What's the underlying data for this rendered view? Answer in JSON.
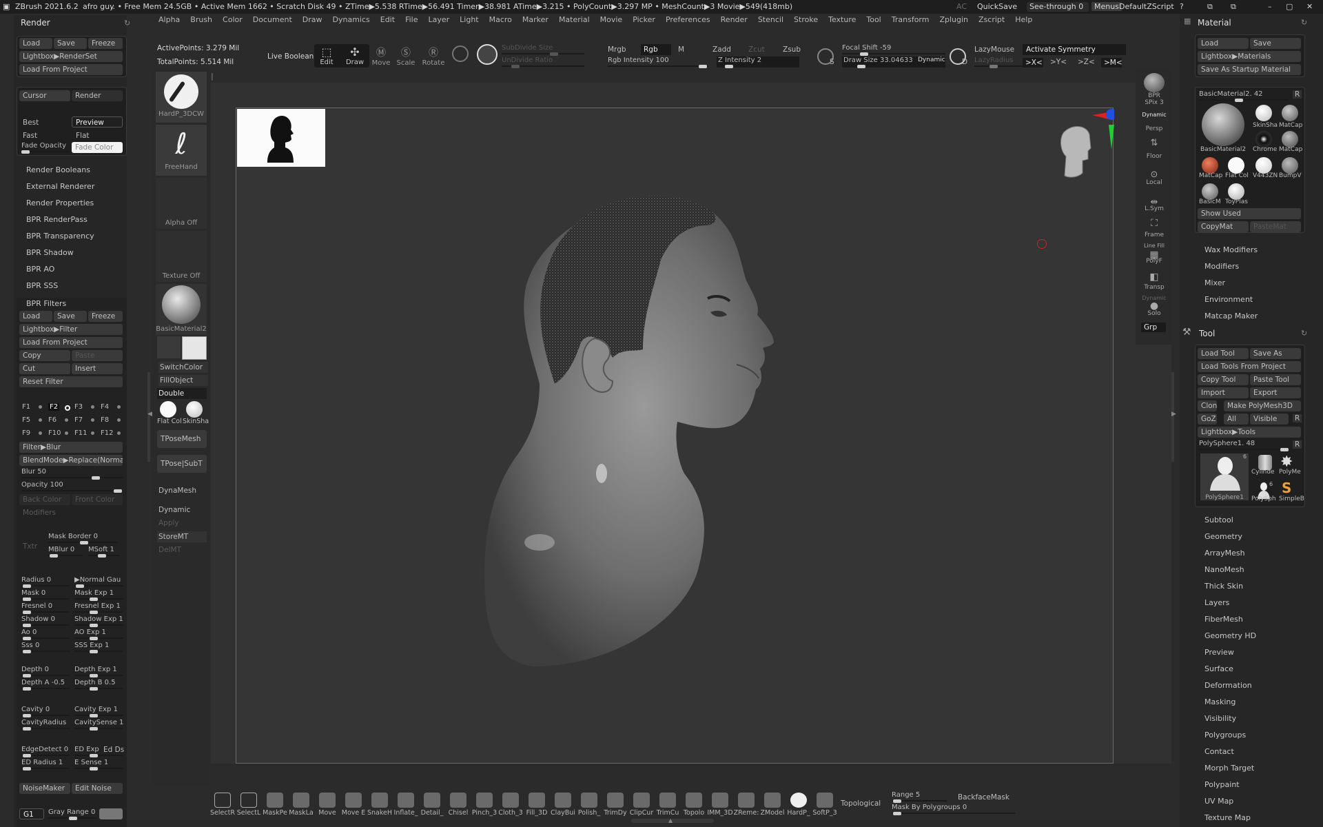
{
  "titlebar": {
    "app": "ZBrush 2021.6.2",
    "project": "afro guy",
    "stats": ".. • Free Mem 24.5GB • Active Mem 1662 • Scratch Disk 49 •  ZTime▶5.538 RTime▶56.491 Timer▶38.981 ATime▶3.215 • PolyCount▶3.297 MP • MeshCount▶3  Movie▶549(418mb)",
    "ac": "AC",
    "quicksave": "QuickSave",
    "seethrough": "See-through  0",
    "menus": "Menus",
    "script": "DefaultZScript"
  },
  "menubar": [
    "Alpha",
    "Brush",
    "Color",
    "Document",
    "Draw",
    "Dynamics",
    "Edit",
    "File",
    "Layer",
    "Light",
    "Macro",
    "Marker",
    "Material",
    "Movie",
    "Picker",
    "Preferences",
    "Render",
    "Stencil",
    "Stroke",
    "Texture",
    "Tool",
    "Transform",
    "Zplugin",
    "Zscript",
    "Help"
  ],
  "left": {
    "title": "Render",
    "load": "Load",
    "save": "Save",
    "freeze": "Freeze",
    "lightbox": "Lightbox▶RenderSet",
    "loadproj": "Load From Project",
    "cursor": "Cursor",
    "render": "Render",
    "best": "Best",
    "preview": "Preview",
    "fast": "Fast",
    "flat": "Flat",
    "fadeopacity": "Fade Opacity",
    "fadecolor": "Fade Color",
    "items": [
      "Render Booleans",
      "External Renderer",
      "Render Properties",
      "BPR RenderPass",
      "BPR Transparency",
      "BPR Shadow",
      "BPR AO",
      "BPR SSS"
    ],
    "filters": "BPR Filters",
    "f_load": "Load",
    "f_save": "Save",
    "f_freeze": "Freeze",
    "f_lightbox": "Lightbox▶Filter",
    "f_loadproj": "Load From Project",
    "copy": "Copy",
    "paste": "Paste",
    "cut": "Cut",
    "insert": "Insert",
    "reset": "Reset Filter",
    "fkeys": [
      "F1",
      "F2",
      "F3",
      "F4",
      "F5",
      "F6",
      "F7",
      "F8",
      "F9",
      "F10",
      "F11",
      "F12"
    ],
    "filterblur": "Filter▶Blur",
    "blendmode": "BlendMode▶Replace(Normal)",
    "blur": "Blur 50",
    "opacity": "Opacity 100",
    "backcolor": "Back Color",
    "frontcolor": "Front Color",
    "modifiers": "Modifiers",
    "txtr": "Txtr",
    "maskborder": "Mask Border  0",
    "mblur": "MBlur  0",
    "msoft": "MSoft  1",
    "radius": "Radius  0",
    "normalgau": "▶Normal Gau",
    "mask": "Mask  0",
    "maskexp": "Mask Exp  1",
    "fresnel": "Fresnel  0",
    "fresnelexp": "Fresnel Exp  1",
    "shadow": "Shadow  0",
    "shadowexp": "Shadow Exp  1",
    "ao": "Ao  0",
    "aoexp": "AO Exp  1",
    "sss": "Sss  0",
    "sssexp": "SSS Exp  1",
    "depth": "Depth  0",
    "depthexp": "Depth Exp  1",
    "deptha": "Depth A  -0.5",
    "depthb": "Depth B  0.5",
    "cavity": "Cavity  0",
    "cavityexp": "Cavity Exp  1",
    "cavityradius": "CavityRadius",
    "cavitysense": "CavitySense  1",
    "edgedetect": "EdgeDetect  0",
    "edexp": "ED Exp",
    "edds": "Ed Ds",
    "edradius": "ED Radius  1",
    "esense": "E Sense  1",
    "noisemaker": "NoiseMaker",
    "editnoise": "Edit Noise",
    "g1": "G1",
    "grayrange": "Gray Range  0"
  },
  "shelf": {
    "brush": "HardP_3DCW",
    "stroke": "FreeHand",
    "alpha": "Alpha Off",
    "texture": "Texture Off",
    "material": "BasicMaterial2",
    "switchcolor": "SwitchColor",
    "fillobject": "FillObject",
    "double": "Double",
    "flatcol": "Flat Col",
    "skinsha": "SkinSha",
    "tposemesh": "TPoseMesh",
    "tposesubt": "TPose|SubT",
    "dynamesh": "DynaMesh",
    "dynamic": "Dynamic",
    "apply": "Apply",
    "storemt": "StoreMT",
    "delmt": "DelMT"
  },
  "topbar": {
    "activepoints": "ActivePoints: 3.279 Mil",
    "totalpoints": "TotalPoints: 5.514 Mil",
    "liveboolean": "Live Boolean",
    "edit": "Edit",
    "draw": "Draw",
    "move": "Move",
    "scale": "Scale",
    "rotate": "Rotate",
    "subdivsize": "SubDivide Size",
    "undivratio": "UnDivide Ratio",
    "mrgb": "Mrgb",
    "rgb": "Rgb",
    "m": "M",
    "rgbintensity": "Rgb Intensity 100",
    "zadd": "Zadd",
    "zcut": "Zcut",
    "zsub": "Zsub",
    "zintensity": "Z Intensity 2",
    "s": "S",
    "focalshift": "Focal Shift  -59",
    "drawsize": "Draw Size  33.04633",
    "dynamic": "Dynamic",
    "d": "D",
    "lazymouse": "LazyMouse",
    "lazyradius": "LazyRadius",
    "activatesym": "Activate Symmetry",
    "symx": ">X<",
    "symy": ">Y<",
    "symz": ">Z<",
    "symm": ">M<"
  },
  "rightstrip": {
    "bpr": "BPR",
    "spix": "SPix 3",
    "dynamic": "Dynamic",
    "persp": "Persp",
    "floor": "Floor",
    "local": "Local",
    "lsym": "L.Sym",
    "frame": "Frame",
    "linefill": "Line Fill",
    "polyf": "PolyF",
    "transp": "Transp",
    "dynamic2": "Dynamic",
    "solo": "Solo",
    "grp": "Grp"
  },
  "material": {
    "title": "Material",
    "load": "Load",
    "save": "Save",
    "lightbox": "Lightbox▶Materials",
    "savestartup": "Save As Startup Material",
    "current": "BasicMaterial2. 42",
    "r": "R",
    "swatches": [
      "SkinSha",
      "MatCap",
      "Chrome",
      "MatCap",
      "BasicMaterial2",
      "MatCap",
      "Flat Col",
      "V443ZN",
      "BumpV",
      "BasicM",
      "ToyPlas"
    ],
    "showused": "Show Used",
    "copymat": "CopyMat",
    "pastemat": "PasteMat",
    "menu": [
      "Wax Modifiers",
      "Modifiers",
      "Mixer",
      "Environment",
      "Matcap Maker"
    ]
  },
  "tool": {
    "title": "Tool",
    "loadtool": "Load Tool",
    "saveas": "Save As",
    "loadfromproj": "Load Tools From Project",
    "copytool": "Copy Tool",
    "pastetool": "Paste Tool",
    "import": "Import",
    "export": "Export",
    "clone": "Clone",
    "makepoly": "Make PolyMesh3D",
    "goz": "GoZ",
    "all": "All",
    "visible": "Visible",
    "r": "R",
    "lightbox": "Lightbox▶Tools",
    "current": "PolySphere1. 48",
    "thumbs": [
      "PolySphere1",
      "Cylinde",
      "PolyMe",
      "PolySph",
      "SimpleB"
    ],
    "count1": "6",
    "count2": "6",
    "menu": [
      "Subtool",
      "Geometry",
      "ArrayMesh",
      "NanoMesh",
      "Thick Skin",
      "Layers",
      "FiberMesh",
      "Geometry HD",
      "Preview",
      "Surface",
      "Deformation",
      "Masking",
      "Visibility",
      "Polygroups",
      "Contact",
      "Morph Target",
      "Polypaint",
      "UV Map",
      "Texture Map"
    ]
  },
  "bottom": {
    "brushes": [
      "SelectR",
      "SelectL",
      "MaskPe",
      "MaskLa",
      "Move",
      "Move E",
      "SnakeH",
      "Inflate_",
      "Detail_",
      "Chisel",
      "Pinch_3",
      "Cloth_3",
      "Fill_3D",
      "ClayBui",
      "Polish_",
      "TrimDy",
      "ClipCur",
      "TrimCu",
      "Topolo",
      "IMM_3D",
      "ZReme:",
      "ZModel",
      "HardP_",
      "SoftP_3"
    ],
    "topological": "Topological",
    "range": "Range 5",
    "backfacemask": "BackfaceMask",
    "maskbypoly": "Mask By Polygroups 0"
  },
  "colors": {
    "accent": "#e8a040",
    "red": "#c0392b",
    "green": "#1abc3c",
    "blue": "#2a6bd8"
  }
}
